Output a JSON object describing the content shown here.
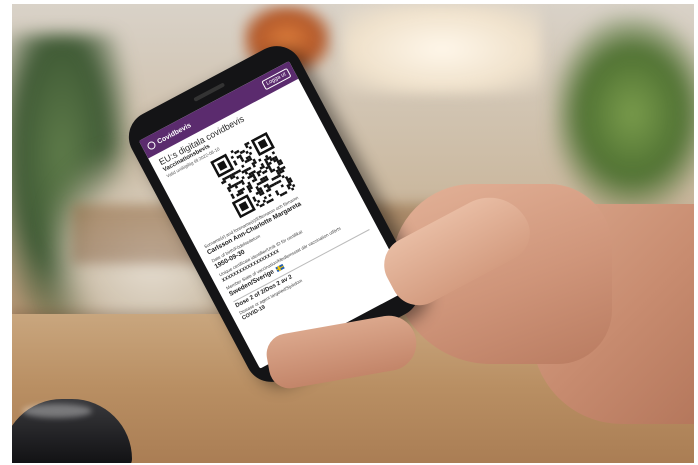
{
  "app": {
    "name": "Covidbevis",
    "logout_label": "Logga ut",
    "logo_icon": "covidbevis-logo-icon"
  },
  "certificate": {
    "title": "EU:s digitala covidbevis",
    "subtitle": "Vaccinationsbevis",
    "validity": "Valid until/giltig till 2022-08-10",
    "name_label": "Surname(s) and forename(s)/Efternamn och förnamn",
    "name_value": "Carlsson Ann-Charlotte Margareta",
    "birth_label": "Date of birth/Födelsedatum",
    "birth_value": "1950-09-30",
    "id_label": "Unique certificate identifier/Unik ID för certifikat",
    "id_value": "XXXXXXXXXXXXXXXXXXXX",
    "country_label": "Member State of vaccination/Medlemsstat där vaccination utförts",
    "country_value": "Sweden/Sverige",
    "dose_value": "Dose 2 of 2/Dos 2 av 2",
    "disease_label": "Disease or agent targeted/Sjukdom",
    "disease_value": "COVID-19"
  },
  "colors": {
    "brand": "#5b2b6e",
    "flag_blue": "#2560b0",
    "flag_yellow": "#f4c400"
  }
}
